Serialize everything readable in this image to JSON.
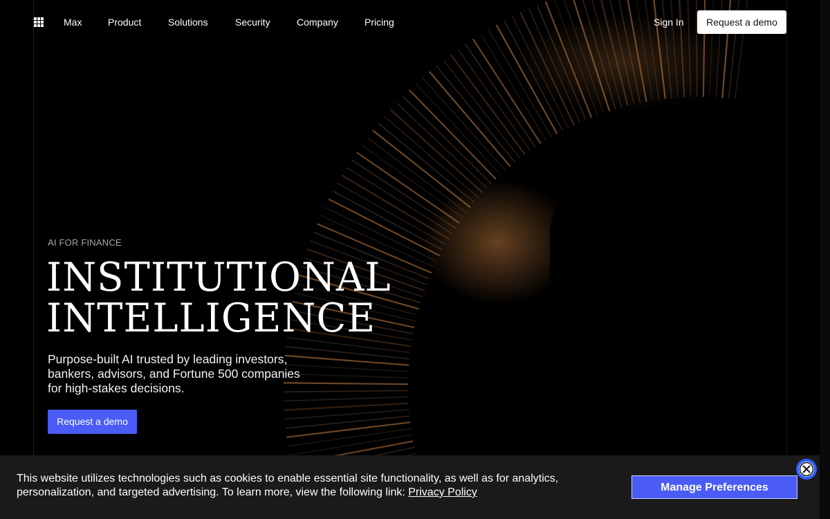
{
  "nav": {
    "menu_icon": "grid-icon",
    "links": [
      "Max",
      "Product",
      "Solutions",
      "Security",
      "Company",
      "Pricing"
    ],
    "sign_in": "Sign In",
    "cta": "Request a demo"
  },
  "hero": {
    "eyebrow": "AI FOR FINANCE",
    "headline_line1": "INSTITUTIONAL",
    "headline_line2": "INTELLIGENCE",
    "subtext": "Purpose-built AI trusted by leading investors, bankers, advisors, and Fortune 500 companies for high-stakes decisions.",
    "cta": "Request a demo"
  },
  "cookie": {
    "text": "This website utilizes technologies such as cookies to enable essential site functionality, as well as for analytics, personalization, and targeted advertising. To learn more, view the following link:",
    "link": "Privacy Policy",
    "manage": "Manage Preferences",
    "close_icon": "close-icon"
  },
  "colors": {
    "accent": "#4a5cf5",
    "background": "#000000",
    "banner": "#1a1a1a"
  }
}
